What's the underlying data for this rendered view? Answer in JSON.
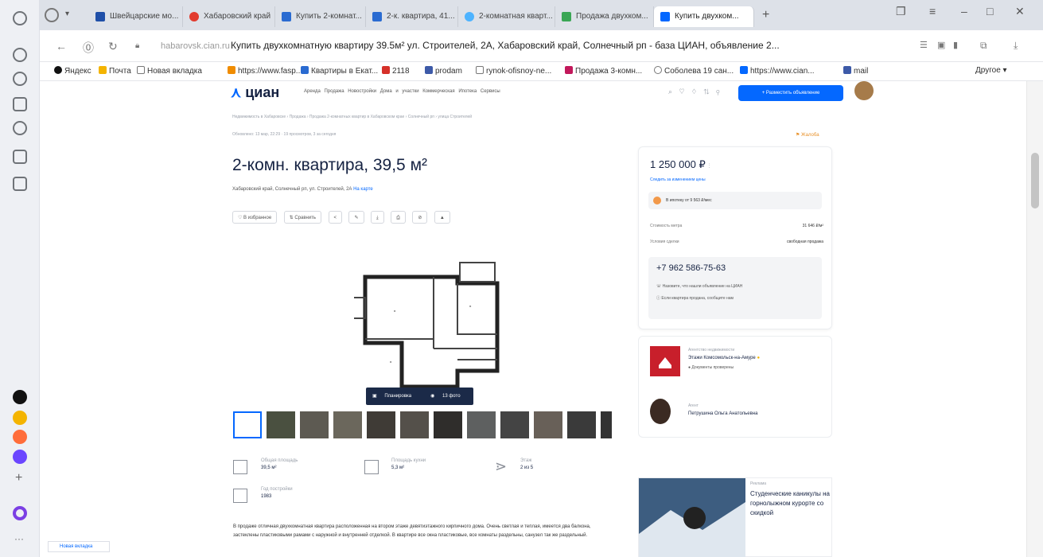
{
  "browser": {
    "tabs": [
      {
        "label": "Швейцарские мо...",
        "color": "#1f4fa8"
      },
      {
        "label": "Хабаровский край",
        "color": "#e23b2e"
      },
      {
        "label": "Купить 2-комнат...",
        "color": "#2a6bd1"
      },
      {
        "label": "2-к. квартира, 41...",
        "color": "#2a6bd1"
      },
      {
        "label": "2-комнатная кварт...",
        "color": "#4db3ff"
      },
      {
        "label": "Продажа двухком...",
        "color": "#3aa655"
      },
      {
        "label": "Купить двухком...",
        "color": "#0468ff"
      }
    ],
    "address_host": "habarovsk.cian.ru",
    "address_title": "Купить двухкомнатную квартиру 39.5м² ул. Строителей, 2А, Хабаровский край, Солнечный рп - база ЦИАН, объявление 2...",
    "bookmarks": [
      "Яндекс",
      "Почта",
      "Новая вкладка",
      "https://www.fasp...",
      "Квартиры в Екат...",
      "2118",
      "prodam",
      "rynok-ofisnoy-ne...",
      "Продажа 3-комн...",
      "Соболева 19 сан...",
      "https://www.cian...",
      "mail",
      "Другое"
    ],
    "status_text": "Новая вкладка"
  },
  "site": {
    "logo": "циан",
    "nav": "Аренда Продажа Новостройки Дома и участки Коммерческая Ипотека Сервисы",
    "post_button": "+ Разместить объявление",
    "breadcrumbs": "Недвижимость в Хабаровске › Продажа › Продажа 2-комнатных квартир в Хабаровском крае › Солнечный рп › улица Строителей",
    "published": "Обновлено: 13 мар, 22:29 · 19 просмотров, 3 за сегодня",
    "complain": "Жалоба",
    "title": "2-комн. квартира, 39,5 м²",
    "address": "Хабаровский край, Солнечный рп, ул. Строителей, 2А",
    "map_link": "На карте",
    "actions": [
      "В избранное",
      "Сравнить"
    ],
    "plan_label": "Планировка",
    "photo_label": "13 фото",
    "specs": [
      {
        "label": "Общая площадь",
        "value": "39,5 м²"
      },
      {
        "label": "Площадь кухни",
        "value": "5,3 м²"
      },
      {
        "label": "Этаж",
        "value": "2 из 5"
      },
      {
        "label": "Год постройки",
        "value": "1983"
      }
    ],
    "description": "В продаже отличная двухкомнатная квартира расположенная на втором этаже девятиэтажного кирпичного дома. Очень светлая и теплая, имеется два балкона, застеклены пластиковыми рамами с наружной и внутренней отделкой. В квартире все окна пластиковые, все комнаты раздельны, санузел так же раздельный."
  },
  "offer": {
    "price": "1 250 000 ₽",
    "price_link": "Следить за изменением цены",
    "mortgage": "В ипотеку от 9 563 ₽/мес",
    "params": [
      {
        "key": "Стоимость метра",
        "value": "31 646 ₽/м²"
      },
      {
        "key": "Условия сделки",
        "value": "свободная продажа"
      }
    ],
    "phone": "+7 962 586-75-63",
    "phone_note1": "Назовите, что нашли объявление на ЦИАН",
    "phone_note2": "Если квартира продана, сообщите нам",
    "agency_label": "Агентство недвижимости",
    "agency_name": "Этажи Комсомольск-на-Амуре",
    "agency_docs": "Документы проверены",
    "agent_label": "Агент",
    "agent_name": "Петрушина Ольга Анатольевна"
  },
  "ad": {
    "label": "Реклама",
    "text": "Студенческие каникулы на горнолыжном курорте со скидкой"
  }
}
